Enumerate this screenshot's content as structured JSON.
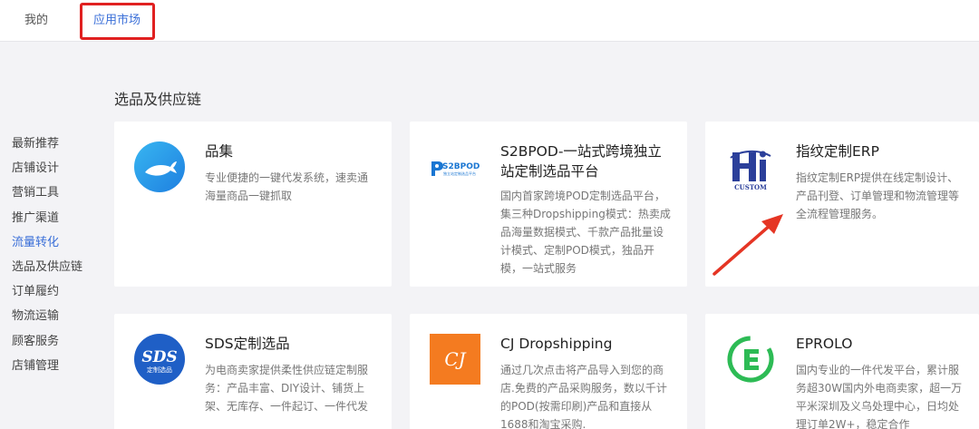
{
  "tabs": {
    "mine": "我的",
    "market": "应用市场"
  },
  "sidebar": {
    "items": [
      {
        "label": "最新推荐"
      },
      {
        "label": "店铺设计"
      },
      {
        "label": "营销工具"
      },
      {
        "label": "推广渠道"
      },
      {
        "label": "流量转化",
        "active": true
      },
      {
        "label": "选品及供应链"
      },
      {
        "label": "订单履约"
      },
      {
        "label": "物流运输"
      },
      {
        "label": "顾客服务"
      },
      {
        "label": "店铺管理"
      }
    ]
  },
  "section": {
    "title": "选品及供应链"
  },
  "cards": [
    {
      "title": "品集",
      "desc": "专业便捷的一键代发系统，速卖通海量商品一键抓取",
      "icon": "whale-icon"
    },
    {
      "title": "S2BPOD-一站式跨境独立站定制选品平台",
      "desc": "国内首家跨境POD定制选品平台，集三种Dropshipping模式：热卖成品海量数据模式、千款产品批量设计模式、定制POD模式，独品开模，一站式服务",
      "logo_text": "S2BPOD",
      "logo_sub": "独立站定制选品平台",
      "icon": "s2bpod-logo"
    },
    {
      "title": "指纹定制ERP",
      "desc": "指纹定制ERP提供在线定制设计、产品刊登、订单管理和物流管理等全流程管理服务。",
      "logo_text": "CUSTOM",
      "icon": "hi-custom-logo"
    },
    {
      "title": "SDS定制选品",
      "desc": "为电商卖家提供柔性供应链定制服务：产品丰富、DIY设计、铺货上架、无库存、一件起订、一件代发",
      "logo_text": "SDS",
      "logo_sub": "定制选品",
      "icon": "sds-logo"
    },
    {
      "title": "CJ Dropshipping",
      "desc": "通过几次点击将产品导入到您的商店.免费的产品采购服务，数以千计的POD(按需印刷)产品和直接从1688和淘宝采购.",
      "logo_text": "CJ",
      "icon": "cj-logo"
    },
    {
      "title": "EPROLO",
      "desc": "国内专业的一件代发平台，累计服务超30W国内外电商卖家，超一万平米深圳及义乌处理中心，日均处理订单2W+，稳定合作",
      "icon": "eprolo-logo"
    }
  ],
  "colors": {
    "accent": "#3a6fd8",
    "highlight": "#e02020",
    "arrow": "#e53524"
  }
}
